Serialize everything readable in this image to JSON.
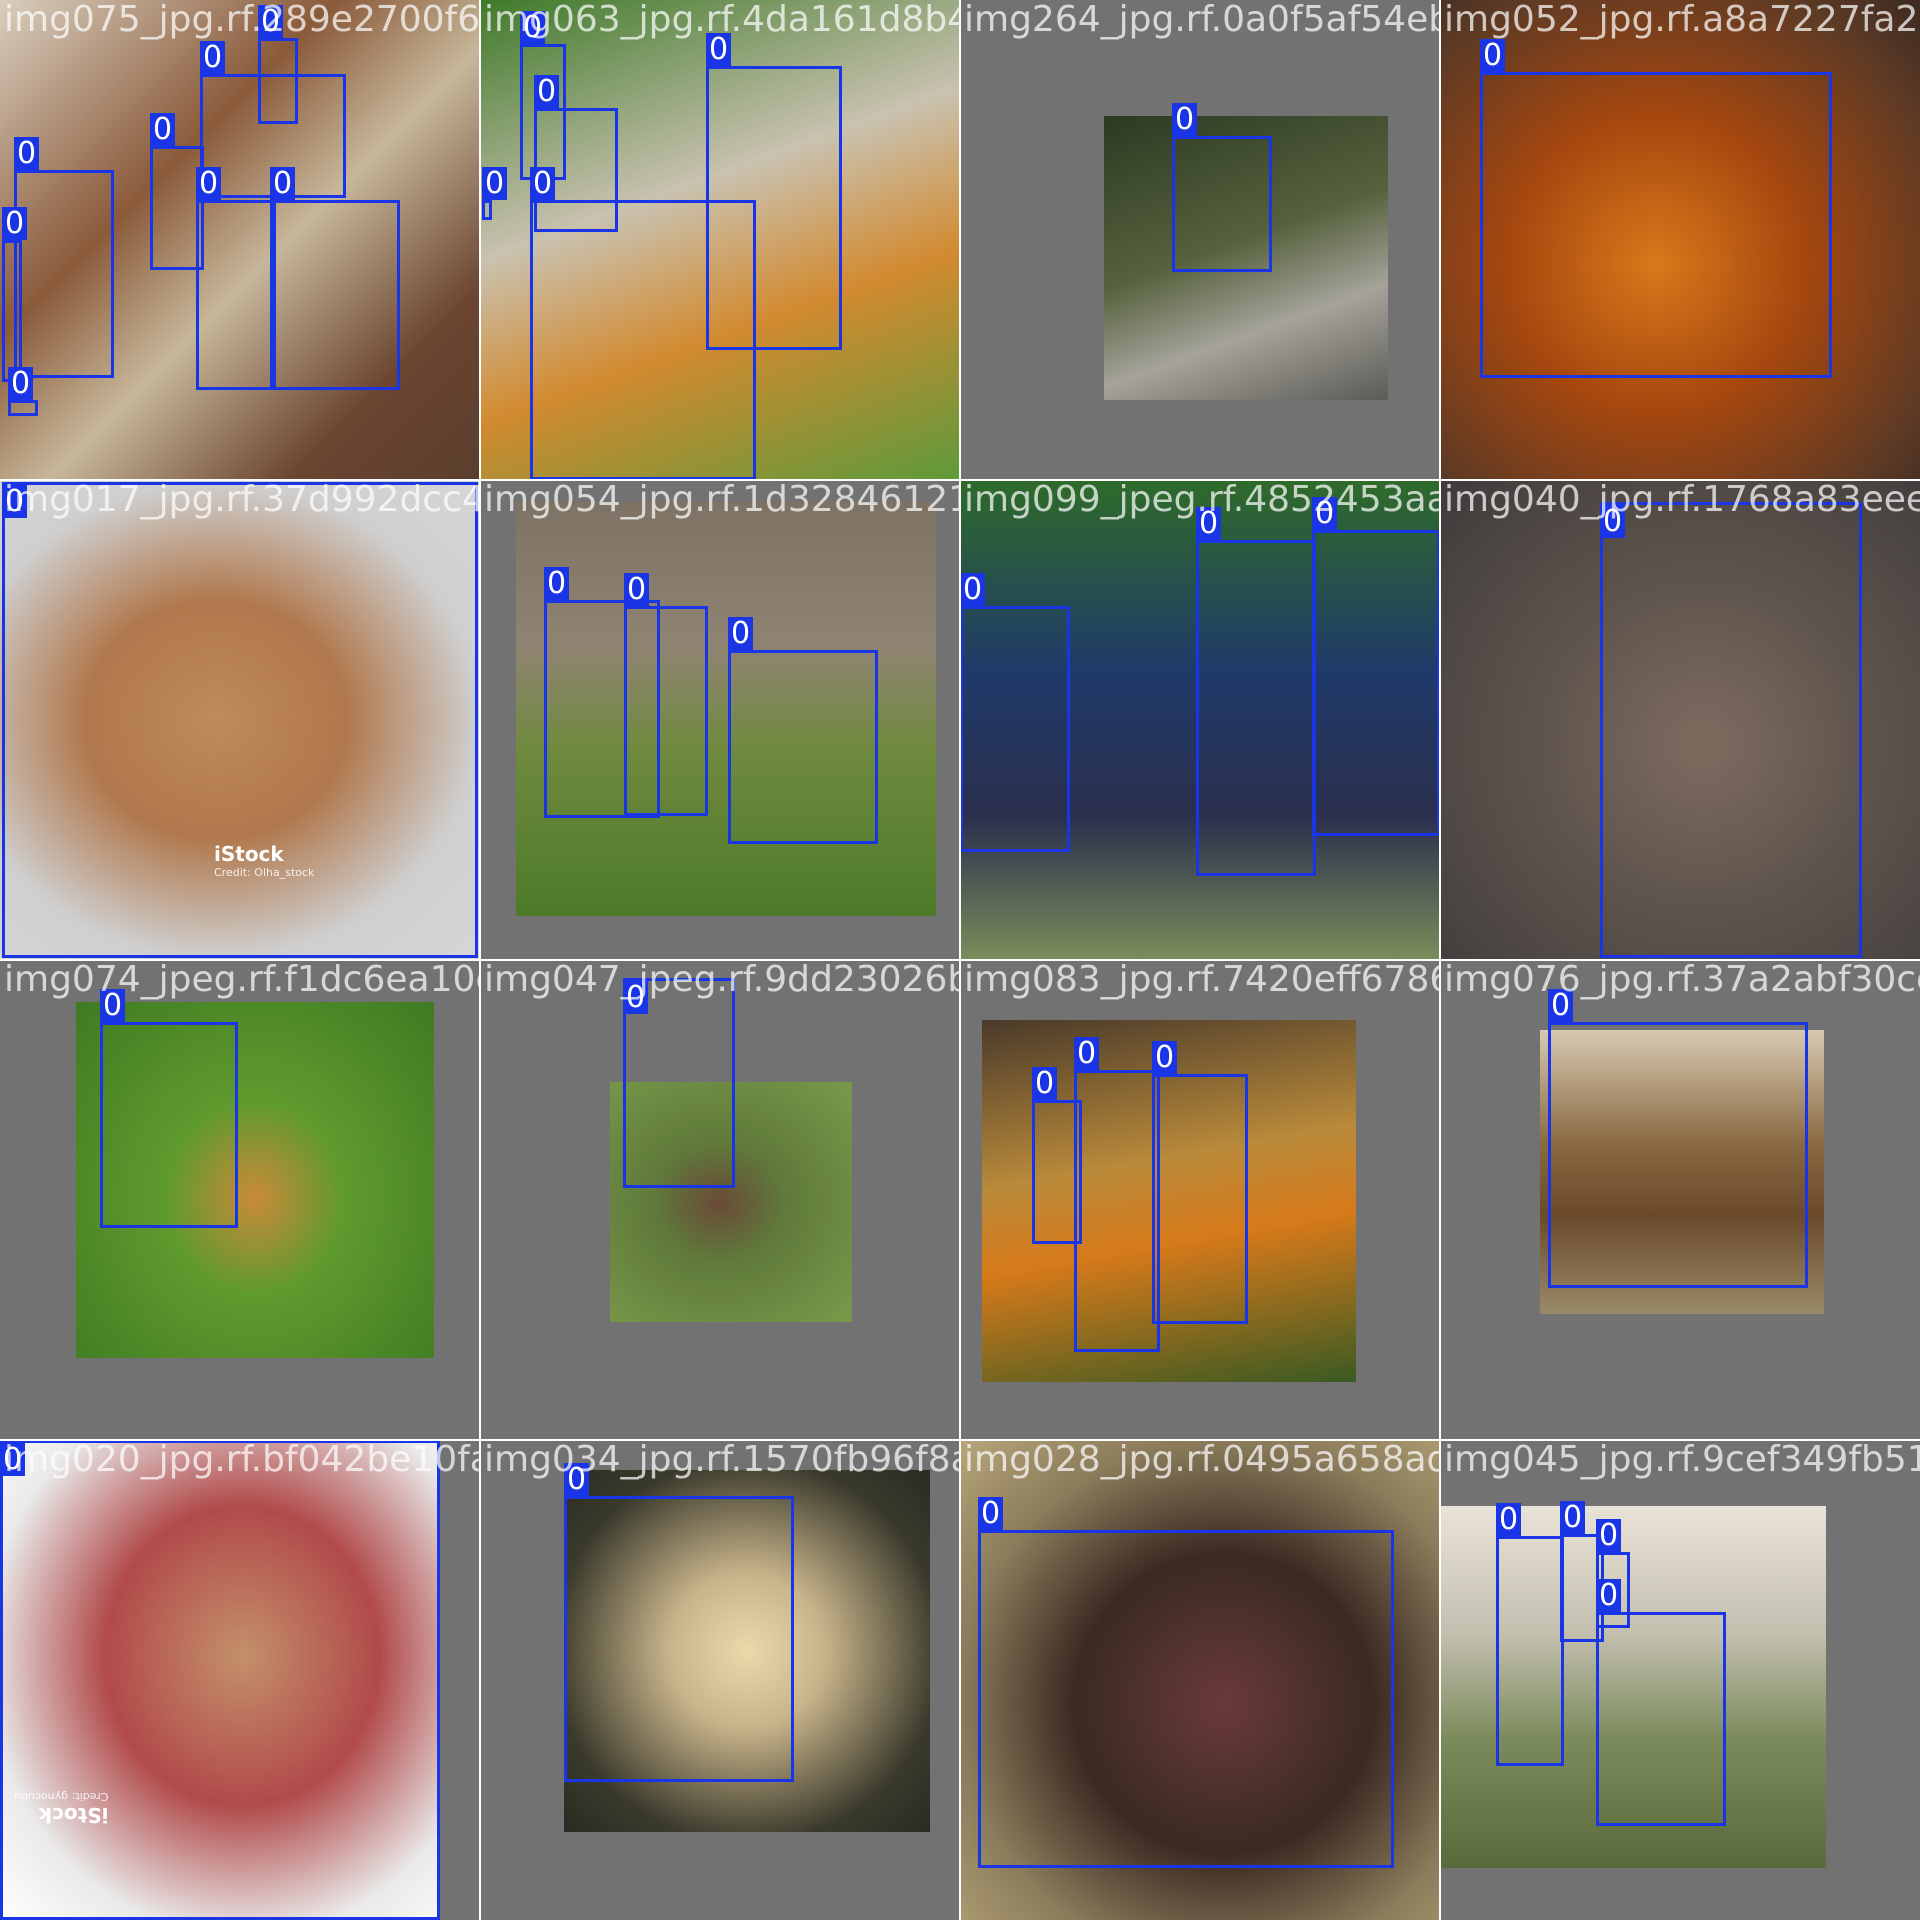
{
  "mosaic": {
    "box_color": "#1a35e6",
    "tiles": [
      {
        "filename": "img075_jpg.rf.289e2700f6f8804c96f6d94df44a421ad49",
        "photo": {
          "kind": "full",
          "bg": "linear-gradient(135deg,#d9cfbf 0%,#8a5a3a 35%,#c7b79a 55%,#6b4530 80%,#5a3e2e 100%)"
        },
        "boxes": [
          {
            "label": "0"
          },
          {
            "label": "0"
          },
          {
            "label": "0"
          },
          {
            "label": "0"
          },
          {
            "label": "0"
          },
          {
            "label": "0"
          },
          {
            "label": "0"
          },
          {
            "label": "0"
          }
        ]
      },
      {
        "filename": "img063_jpg.rf.4da161d8b4d4a421ad494fab264e6ea0f5a",
        "photo": {
          "kind": "full",
          "bg": "linear-gradient(160deg,#3f7a2a 0%,#c9c2b0 40%,#d28a2f 65%,#5e9a3b 100%)"
        },
        "boxes": [
          {
            "label": "0"
          },
          {
            "label": "0"
          },
          {
            "label": "0"
          },
          {
            "label": "0"
          },
          {
            "label": "0"
          }
        ]
      },
      {
        "filename": "img264_jpg.rf.0a0f5af54eb2306d4a90d5237227fa2264",
        "photo": {
          "kind": "inset",
          "bg": "linear-gradient(160deg,#2c3a22 0%,#56613d 45%,#a5a39a 70%,#5b5a55 100%)"
        },
        "boxes": [
          {
            "label": "0"
          }
        ]
      },
      {
        "filename": "img052_jpg.rf.a8a7227fa2264fc40ec6c",
        "photo": {
          "kind": "full",
          "bg": "radial-gradient(ellipse at 45% 55%,#d9781a 0%,#a5470f 40%,#5c3a25 80%,#3c2a20 100%)"
        },
        "boxes": [
          {
            "label": "0"
          }
        ]
      },
      {
        "filename": "img017_jpg.rf.37d992dcc41368078a2d1c8b4612126dd",
        "photo": {
          "kind": "full",
          "bg": "radial-gradient(ellipse at 45% 50%,#c08a5c 0%,#b0784c 35%,#cfcfcf 70%,#d6d6d6 100%)"
        },
        "watermark": {
          "main": "iStock",
          "sub": "Credit: Olha_stock"
        },
        "boxes": [
          {
            "label": "0"
          }
        ]
      },
      {
        "filename": "img054_jpg.rf.1d3284612126dd9a099bde07185245",
        "photo": {
          "kind": "inset",
          "bg": "linear-gradient(180deg,#7d7264 0%,#8f8472 35%,#6f8a3e 60%,#4d7a2a 100%)"
        },
        "boxes": [
          {
            "label": "0"
          },
          {
            "label": "0"
          },
          {
            "label": "0"
          }
        ]
      },
      {
        "filename": "img099_jpeg.rf.4852453aad144704c5f7eb1768a83eee89",
        "photo": {
          "kind": "full",
          "bg": "linear-gradient(180deg,#2f6b2a 0%,#1f3a6a 40%,#2a2f4d 70%,#7b8d5a 100%)"
        },
        "boxes": [
          {
            "label": "0"
          },
          {
            "label": "0"
          },
          {
            "label": "0"
          }
        ]
      },
      {
        "filename": "img040_jpg.rf.1768a83eee89",
        "photo": {
          "kind": "full",
          "bg": "radial-gradient(ellipse at 55% 55%,#7e6b5f 0%,#5e544c 45%,#4a4442 80%,#3e3a3a 100%)"
        },
        "boxes": [
          {
            "label": "0"
          }
        ]
      },
      {
        "filename": "img074_jpeg.rf.f1dc6ea10e1591047fce2437",
        "photo": {
          "kind": "inset",
          "bg": "radial-gradient(ellipse at 50% 55%,#c98a3a 0%,#5f9a2e 35%,#3f7a22 100%)"
        },
        "boxes": [
          {
            "label": "0"
          }
        ]
      },
      {
        "filename": "img047_jpeg.rf.9dd23026be7557083",
        "photo": {
          "kind": "inset",
          "bg": "radial-gradient(ellipse at 45% 50%,#6a4a38 0%,#5f7a3a 35%,#7a9a4a 100%)"
        },
        "boxes": [
          {
            "label": "0"
          }
        ]
      },
      {
        "filename": "img083_jpg.rf.7420eff678633a0a0776f3",
        "photo": {
          "kind": "inset",
          "bg": "linear-gradient(170deg,#4a3a2a 0%,#b98a3a 40%,#d77a1a 60%,#3a5a22 100%)"
        },
        "boxes": [
          {
            "label": "0"
          },
          {
            "label": "0"
          },
          {
            "label": "0"
          }
        ]
      },
      {
        "filename": "img076_jpg.rf.37a2abf30ce2cf1",
        "photo": {
          "kind": "inset",
          "bg": "linear-gradient(180deg,#d7c9b2 0%,#8a6a42 40%,#6a4a2a 65%,#9a8a6a 100%)"
        },
        "boxes": [
          {
            "label": "0"
          }
        ]
      },
      {
        "filename": "img020_jpg.rf.bf042be10fa2628334",
        "photo": {
          "kind": "full",
          "bg": "radial-gradient(ellipse at 55% 45%,#c4906a 0%,#b14a4a 40%,#eaeaea 75%,#ffffff 100%)"
        },
        "watermark": {
          "main": "iStock",
          "sub": "Credit: gynocubu"
        },
        "boxes": [
          {
            "label": "0"
          }
        ]
      },
      {
        "filename": "img034_jpg.rf.1570fb96f8a33d28191",
        "photo": {
          "kind": "inset",
          "bg": "radial-gradient(ellipse at 50% 50%,#ecd9aa 0%,#c8b48a 30%,#3a3a2c 75%,#2a2a22 100%)"
        },
        "boxes": [
          {
            "label": "0"
          }
        ]
      },
      {
        "filename": "img028_jpg.rf.0495a658adba5c0421",
        "photo": {
          "kind": "full",
          "bg": "radial-gradient(ellipse at 55% 55%,#6a3a3a 0%,#3a2a22 40%,#8a7a5a 70%,#b8a77a 100%)"
        },
        "boxes": [
          {
            "label": "0"
          }
        ]
      },
      {
        "filename": "img045_jpg.rf.9cef349fb51490ab",
        "photo": {
          "kind": "inset",
          "bg": "linear-gradient(180deg,#e9e3d7 0%,#c4c0b0 35%,#7a8a5a 65%,#5a6a3a 100%)"
        },
        "boxes": [
          {
            "label": "0"
          },
          {
            "label": "0"
          },
          {
            "label": "0"
          },
          {
            "label": "0"
          }
        ]
      }
    ]
  }
}
